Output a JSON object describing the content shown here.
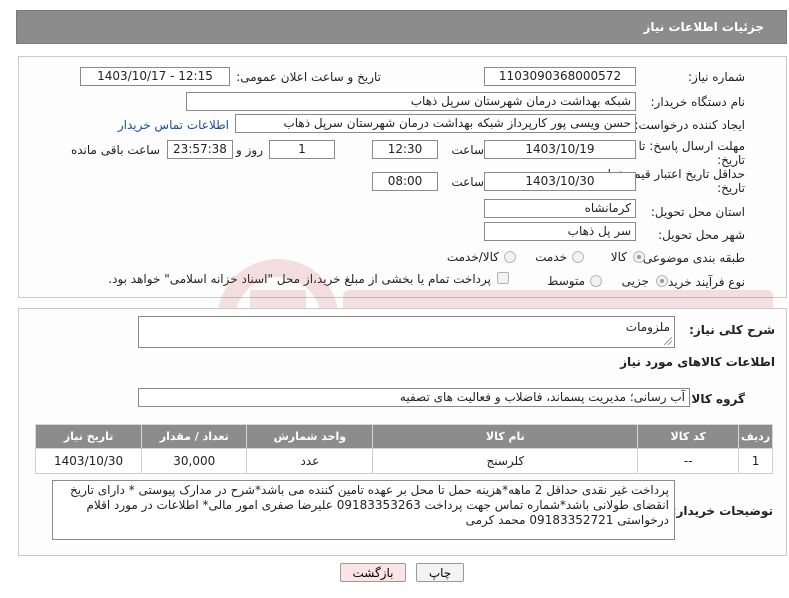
{
  "header": {
    "title": "جزئیات اطلاعات نیاز"
  },
  "fields": {
    "need_number_label": "شماره نیاز:",
    "need_number": "1103090368000572",
    "announce_label": "تاریخ و ساعت اعلان عمومی:",
    "announce_value": "1403/10/17 - 12:15",
    "buyer_org_label": "نام دستگاه خریدار:",
    "buyer_org": "شبکه بهداشت درمان شهرستان سرپل ذهاب",
    "creator_label": "ایجاد کننده درخواست:",
    "creator": "حسن ویسی پور کارپرداز شبکه بهداشت درمان شهرستان سرپل ذهاب",
    "contact_link": "اطلاعات تماس خریدار",
    "reply_deadline_label_1": "مهلت ارسال پاسخ: تا",
    "reply_deadline_label_2": "تاریخ:",
    "reply_date": "1403/10/19",
    "time_label": "ساعت",
    "reply_time": "12:30",
    "days_value": "1",
    "days_label": "روز و",
    "remaining_time": "23:57:38",
    "remaining_label": "ساعت باقی مانده",
    "price_validity_label_1": "حداقل تاریخ اعتبار قیمت: تا",
    "price_validity_label_2": "تاریخ:",
    "price_date": "1403/10/30",
    "price_time_label": "ساعت",
    "price_time": "08:00",
    "province_label": "استان محل تحویل:",
    "province": "کرمانشاه",
    "city_label": "شهر محل تحویل:",
    "city": "سر پل ذهاب",
    "category_label": "طبقه بندی موضوعی:",
    "category_options": [
      "کالا",
      "خدمت",
      "کالا/خدمت"
    ],
    "purchase_type_label": "نوع فرآیند خرید :",
    "purchase_options": [
      "جزیی",
      "متوسط"
    ],
    "payment_note": "پرداخت تمام یا بخشی از مبلغ خرید،از محل \"اسناد خزانه اسلامی\" خواهد بود."
  },
  "description": {
    "label": "شرح کلی نیاز:",
    "value": "ملزومات"
  },
  "goods": {
    "section_title": "اطلاعات کالاهای مورد نیاز",
    "group_label": "گروه کالا:",
    "group_value": "آب رسانی؛ مدیریت پسماند، فاضلاب و فعالیت های تصفیه",
    "columns": [
      "ردیف",
      "کد کالا",
      "نام کالا",
      "واحد شمارش",
      "تعداد / مقدار",
      "تاریخ نیاز"
    ],
    "rows": [
      [
        "1",
        "--",
        "کلرسنج",
        "عدد",
        "30,000",
        "1403/10/30"
      ]
    ]
  },
  "buyer_notes": {
    "label": "توضیحات خریدار:",
    "value": "پرداخت غیر نقدی حداقل 2 ماهه*هزینه حمل تا محل بر عهده تامین کننده می باشد*شرح در مدارک پیوستی * دارای تاریخ انقضای طولانی باشد*شماره تماس جهت پرداخت 09183353263 علیرضا صفری امور مالی* اطلاعات در مورد اقلام درخواستی 09183352721 محمد کرمی"
  },
  "buttons": {
    "print": "چاپ",
    "back": "بازگشت"
  },
  "colors": {
    "header_bg": "#8c8c8c",
    "link": "#1a4fa0",
    "back_button_bg": "#fbe4e4"
  }
}
